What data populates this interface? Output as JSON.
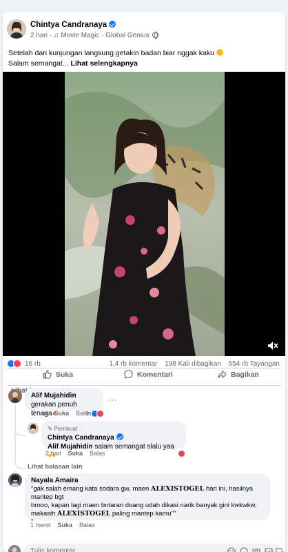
{
  "post": {
    "author": "Chintya Candranaya",
    "time": "2 hari",
    "music": "Movie Magic · Global Genius",
    "caption_line1": "Setelah dari kunjungan langsung getakin badan biar nggak kaku",
    "caption_line2": "Salam semangat...",
    "see_more": "Lihat selengkapnya"
  },
  "stats": {
    "reactions": "16 rb",
    "comments": "1,4 rb komentar",
    "shares": "198 Kali dibagikan",
    "views": "554 rb Tayangan"
  },
  "actions": {
    "like": "Suka",
    "comment": "Komentari",
    "share": "Bagikan"
  },
  "more_comments": "Lihat komentar lain",
  "comments": [
    {
      "name": "Alif Mujahidin",
      "text": "gerakan penuh tenaga",
      "time": "2 hari",
      "like": "Suka",
      "reply": "Balas",
      "reaction_count": "9"
    }
  ],
  "reply": {
    "badge": "Pembuat",
    "name": "Chintya Candranaya",
    "mention": "Alif Mujahidin",
    "text": "salam semangat slalu yaa",
    "time": "2 hari",
    "like": "Suka",
    "reply": "Balas"
  },
  "more_replies": "Lihat balasan lain",
  "comment2": {
    "name": "Nayala Amaira",
    "text_a": "\"gak salah emang kata sodara gw, maen",
    "brand": "ALEXISTOGEL",
    "text_b": "hari ini, hasilnya mantep bgt",
    "line2": "brooo, kapan lagi maen bntaran doang udah dikasi narik banyak gini kwkwkw,",
    "line3a": "makasih",
    "line3b": "paling mantep kamu\"\"",
    "line4": "\"",
    "time": "1 menit",
    "like": "Suka",
    "reply": "Balas"
  },
  "composer": {
    "placeholder": "Tulis komentar..."
  },
  "colors": {
    "accent": "#1877f2",
    "love": "#f33e58",
    "muted": "#65676b",
    "bubble": "#f0f2f5"
  }
}
